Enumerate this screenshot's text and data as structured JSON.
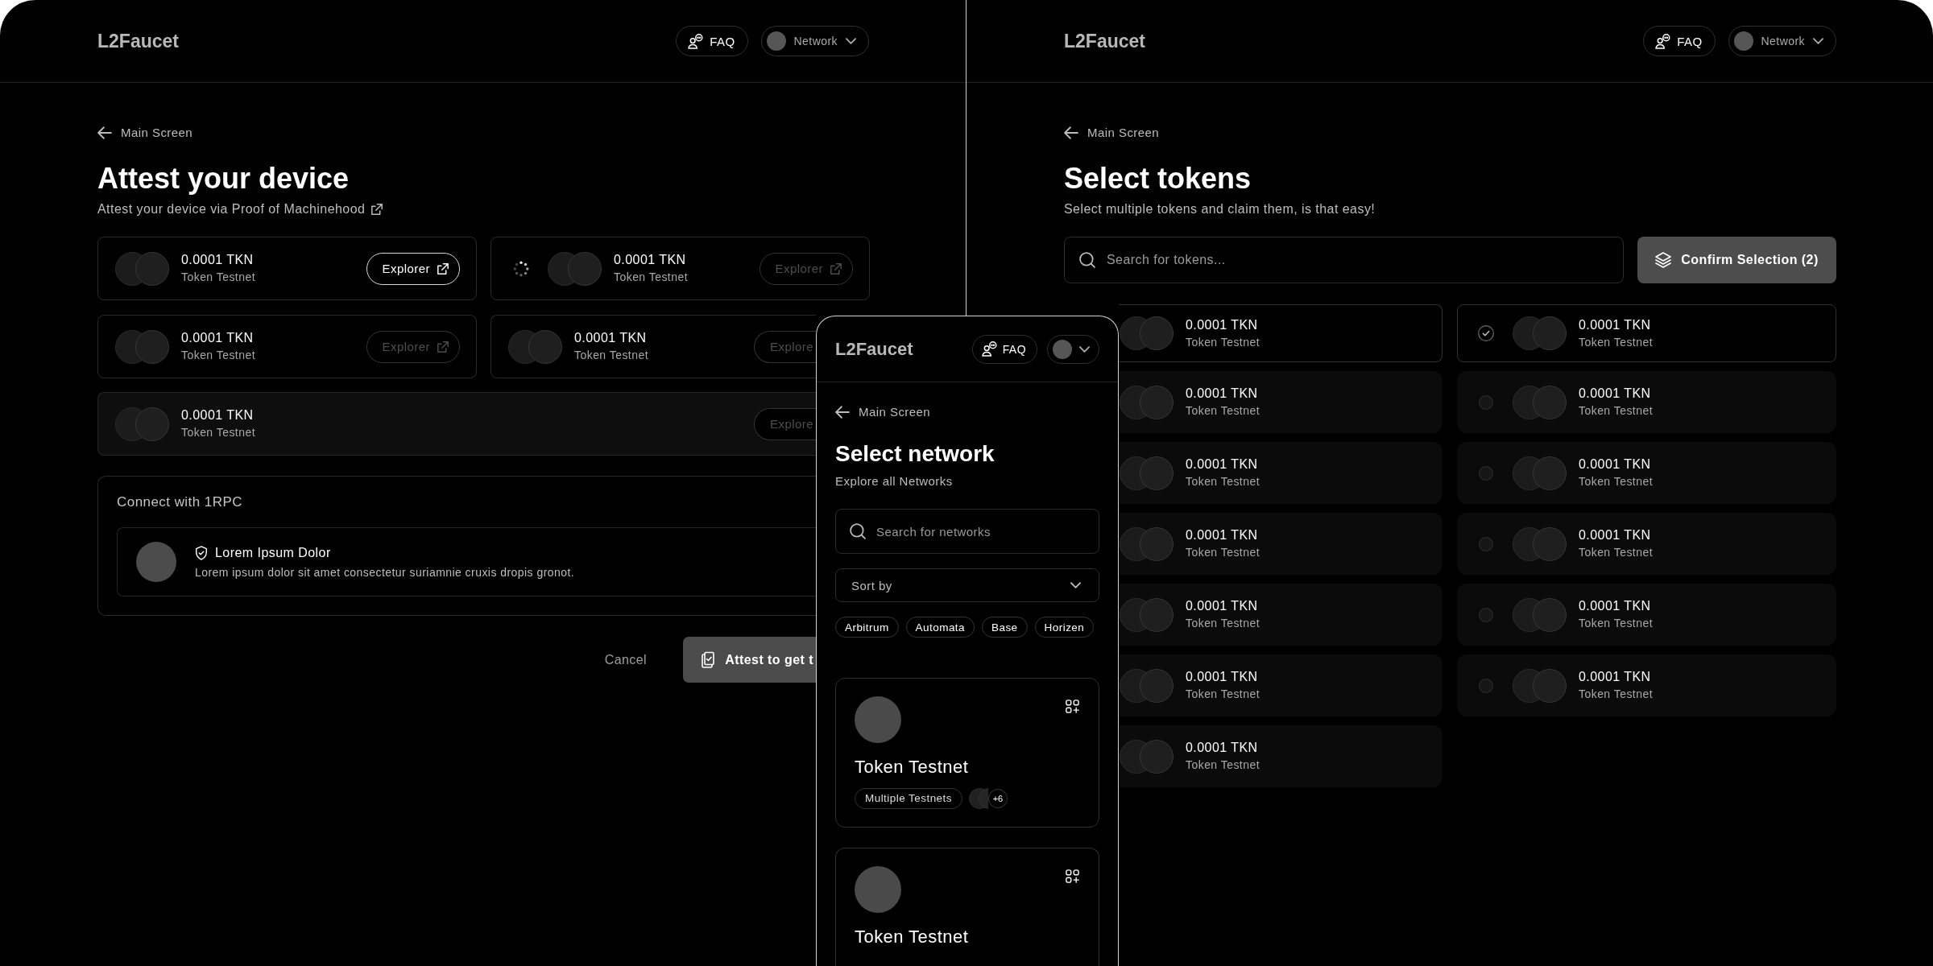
{
  "attest_screen": {
    "header": {
      "logo": "L2Faucet",
      "faq": "FAQ",
      "network": "Network"
    },
    "back_link": "Main Screen",
    "title": "Attest your device",
    "subtitle": "Attest your device via Proof of Machinehood",
    "token_rows": [
      [
        {
          "amount": "0.0001 TKN",
          "network": "Token Testnet",
          "loading": false,
          "highlighted": false,
          "explorer": {
            "label": "Explorer",
            "disabled": false
          }
        },
        {
          "amount": "0.0001 TKN",
          "network": "Token Testnet",
          "loading": true,
          "highlighted": false,
          "explorer": {
            "label": "Explorer",
            "disabled": true
          }
        }
      ],
      [
        {
          "amount": "0.0001 TKN",
          "network": "Token Testnet",
          "loading": false,
          "highlighted": false,
          "explorer": {
            "label": "Explorer",
            "disabled": true
          }
        },
        {
          "amount": "0.0001 TKN",
          "network": "Token Testnet",
          "loading": false,
          "highlighted": false,
          "explorer": {
            "label": "Explore",
            "disabled": true
          }
        }
      ],
      [
        {
          "amount": "0.0001 TKN",
          "network": "Token Testnet",
          "loading": false,
          "highlighted": true,
          "explorer": {
            "label": "Explore",
            "disabled": true
          }
        }
      ]
    ],
    "connect": {
      "title": "Connect with 1RPC",
      "provider": {
        "name": "Lorem Ipsum Dolor",
        "description": "Lorem ipsum dolor sit amet consectetur suriamnie cruxis dropis gronot."
      }
    },
    "actions": {
      "cancel": "Cancel",
      "attest": "Attest to get t"
    }
  },
  "select_tokens_screen": {
    "header": {
      "logo": "L2Faucet",
      "faq": "FAQ",
      "network": "Network"
    },
    "back_link": "Main Screen",
    "title": "Select tokens",
    "subtitle": "Select multiple tokens and claim them, is that easy!",
    "search": {
      "placeholder": "Search for tokens..."
    },
    "confirm_button": "Confirm Selection (2)",
    "token_rows": [
      [
        {
          "amount": "0.0001 TKN",
          "network": "Token Testnet",
          "selected": true
        },
        {
          "amount": "0.0001 TKN",
          "network": "Token Testnet",
          "selected": true
        }
      ],
      [
        {
          "amount": "0.0001 TKN",
          "network": "Token Testnet",
          "selected": false
        },
        {
          "amount": "0.0001 TKN",
          "network": "Token Testnet",
          "selected": false
        }
      ],
      [
        {
          "amount": "0.0001 TKN",
          "network": "Token Testnet",
          "selected": false
        },
        {
          "amount": "0.0001 TKN",
          "network": "Token Testnet",
          "selected": false
        }
      ],
      [
        {
          "amount": "0.0001 TKN",
          "network": "Token Testnet",
          "selected": false
        },
        {
          "amount": "0.0001 TKN",
          "network": "Token Testnet",
          "selected": false
        }
      ],
      [
        {
          "amount": "0.0001 TKN",
          "network": "Token Testnet",
          "selected": false
        },
        {
          "amount": "0.0001 TKN",
          "network": "Token Testnet",
          "selected": false
        }
      ],
      [
        {
          "amount": "0.0001 TKN",
          "network": "Token Testnet",
          "selected": false
        },
        {
          "amount": "0.0001 TKN",
          "network": "Token Testnet",
          "selected": false
        }
      ],
      [
        {
          "amount": "0.0001 TKN",
          "network": "Token Testnet",
          "selected": false
        }
      ]
    ]
  },
  "select_network_screen": {
    "header": {
      "logo": "L2Faucet",
      "faq": "FAQ"
    },
    "back_link": "Main Screen",
    "title": "Select network",
    "subtitle": "Explore all Networks",
    "search": {
      "placeholder": "Search for networks"
    },
    "sort": {
      "label": "Sort by"
    },
    "filters": [
      "Arbitrum",
      "Automata",
      "Base",
      "Horizen"
    ],
    "networks": [
      {
        "name": "Token Testnet",
        "tags": [
          "Multiple Testnets"
        ],
        "more_count": "+6"
      },
      {
        "name": "Token Testnet"
      }
    ]
  }
}
